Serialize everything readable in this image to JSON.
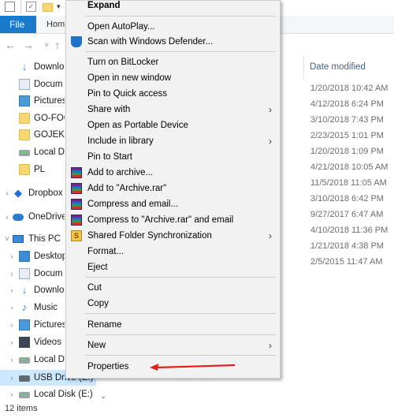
{
  "ribbon": {
    "file_tab": "File",
    "home_tab": "Hom"
  },
  "tree": {
    "items": [
      {
        "label": "Downlo",
        "icon": "download-arrow-icon",
        "name": "tree-item-downloads-quick"
      },
      {
        "label": "Docum",
        "icon": "document-icon",
        "name": "tree-item-documents-quick"
      },
      {
        "label": "Pictures",
        "icon": "pictures-folder-icon",
        "name": "tree-item-pictures-quick"
      },
      {
        "label": "GO-FOO",
        "icon": "folder-icon",
        "name": "tree-item-go-foo"
      },
      {
        "label": "GOJEK",
        "icon": "folder-icon",
        "name": "tree-item-gojek"
      },
      {
        "label": "Local D",
        "icon": "drive-icon",
        "name": "tree-item-local-disk-quick"
      },
      {
        "label": "PL",
        "icon": "folder-icon",
        "name": "tree-item-pl"
      },
      {
        "label": "Dropbox",
        "icon": "dropbox-icon",
        "name": "tree-item-dropbox"
      },
      {
        "label": "OneDrive",
        "icon": "cloud-icon",
        "name": "tree-item-onedrive"
      },
      {
        "label": "This PC",
        "icon": "computer-icon",
        "name": "tree-item-this-pc"
      },
      {
        "label": "Desktop",
        "icon": "desktop-folder-icon",
        "name": "tree-item-desktop"
      },
      {
        "label": "Docum",
        "icon": "document-icon",
        "name": "tree-item-documents"
      },
      {
        "label": "Downlo",
        "icon": "download-arrow-icon",
        "name": "tree-item-downloads"
      },
      {
        "label": "Music",
        "icon": "music-icon",
        "name": "tree-item-music"
      },
      {
        "label": "Pictures",
        "icon": "pictures-folder-icon",
        "name": "tree-item-pictures"
      },
      {
        "label": "Videos",
        "icon": "video-icon",
        "name": "tree-item-videos"
      },
      {
        "label": "Local D",
        "icon": "drive-icon",
        "name": "tree-item-local-disk"
      },
      {
        "label": "USB Drive (E:)",
        "icon": "usb-drive-icon",
        "name": "tree-item-usb-drive"
      },
      {
        "label": "Local Disk (E:)",
        "icon": "drive-icon",
        "name": "tree-item-local-disk-e"
      }
    ]
  },
  "list": {
    "date_header": "Date modified",
    "dates": [
      "1/20/2018 10:42 AM",
      "4/12/2018 6:24 PM",
      "3/10/2018 7:43 PM",
      "2/23/2015 1:01 PM",
      "1/20/2018 1:09 PM",
      "4/21/2018 10:05 AM",
      "11/5/2018 11:05 AM",
      "3/10/2018 6:42 PM",
      "9/27/2017 6:47 AM",
      "4/10/2018 11:36 PM",
      "1/21/2018 4:38 PM",
      "2/5/2015 11:47 AM"
    ]
  },
  "status": {
    "items_count": "12 items"
  },
  "menu": {
    "expand": "Expand",
    "open_autoplay": "Open AutoPlay...",
    "scan_defender": "Scan with Windows Defender...",
    "bitlocker": "Turn on BitLocker",
    "open_new_window": "Open in new window",
    "pin_quick_access": "Pin to Quick access",
    "share_with": "Share with",
    "open_portable": "Open as Portable Device",
    "include_library": "Include in library",
    "pin_start": "Pin to Start",
    "add_archive": "Add to archive...",
    "add_archive_rar": "Add to \"Archive.rar\"",
    "compress_email": "Compress and email...",
    "compress_rar_email": "Compress to \"Archive.rar\" and email",
    "shared_sync": "Shared Folder Synchronization",
    "format": "Format...",
    "eject": "Eject",
    "cut": "Cut",
    "copy": "Copy",
    "rename": "Rename",
    "new": "New",
    "properties": "Properties"
  },
  "colors": {
    "accent": "#1979ca",
    "selection": "#cce8ff",
    "annotation_arrow": "#e0201c"
  }
}
